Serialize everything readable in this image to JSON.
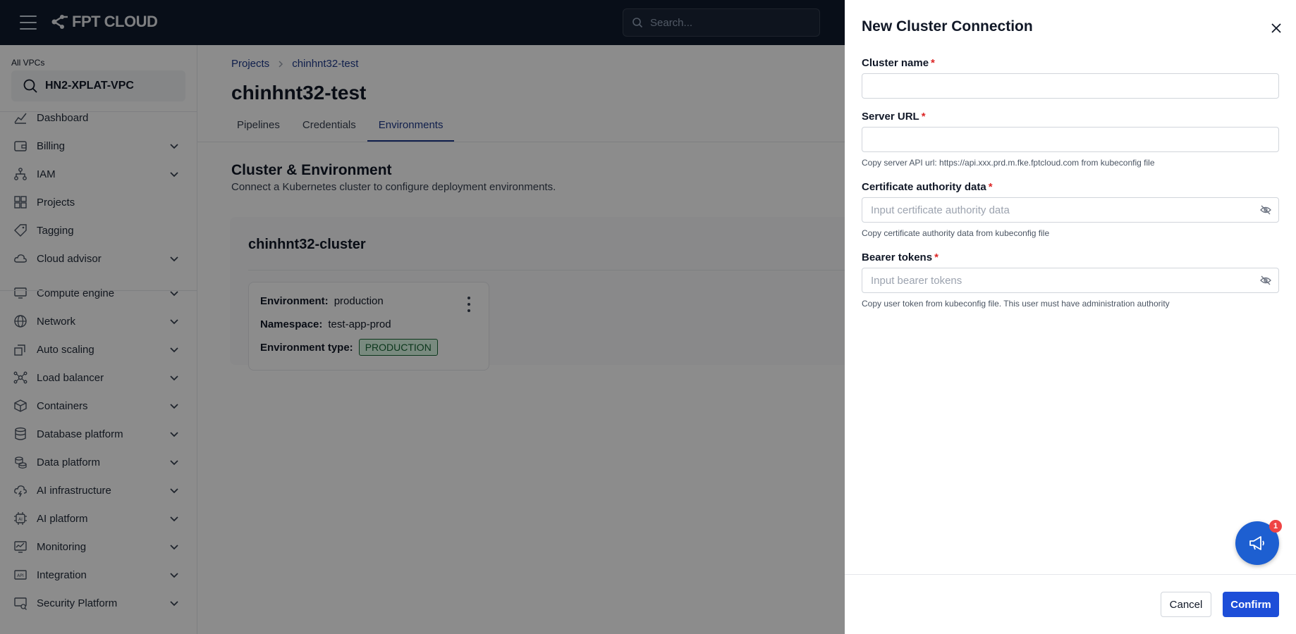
{
  "topbar": {
    "logo_text": "FPT CLOUD",
    "search_placeholder": "Search..."
  },
  "sidebar": {
    "vpc_label": "All VPCs",
    "vpc_name": "HN2-XPLAT-VPC",
    "items": [
      {
        "label": "Dashboard",
        "icon": "chart-line-icon",
        "expandable": false
      },
      {
        "label": "Billing",
        "icon": "wallet-icon",
        "expandable": true
      },
      {
        "label": "IAM",
        "icon": "hierarchy-icon",
        "expandable": true
      },
      {
        "label": "Projects",
        "icon": "grid-icon",
        "expandable": false
      },
      {
        "label": "Tagging",
        "icon": "tag-icon",
        "expandable": false
      },
      {
        "label": "Cloud advisor",
        "icon": "cloud-icon",
        "expandable": true
      },
      {
        "label": "Compute engine",
        "icon": "monitor-icon",
        "expandable": true
      },
      {
        "label": "Network",
        "icon": "globe-icon",
        "expandable": true
      },
      {
        "label": "Auto scaling",
        "icon": "scaling-icon",
        "expandable": true
      },
      {
        "label": "Load balancer",
        "icon": "network-nodes-icon",
        "expandable": true
      },
      {
        "label": "Containers",
        "icon": "box-icon",
        "expandable": true
      },
      {
        "label": "Database platform",
        "icon": "database-icon",
        "expandable": true
      },
      {
        "label": "Data platform",
        "icon": "coins-icon",
        "expandable": true
      },
      {
        "label": "AI infrastructure",
        "icon": "cloud-bolt-icon",
        "expandable": true
      },
      {
        "label": "AI platform",
        "icon": "ai-chip-icon",
        "expandable": true
      },
      {
        "label": "Monitoring",
        "icon": "monitoring-icon",
        "expandable": true
      },
      {
        "label": "Integration",
        "icon": "api-icon",
        "expandable": true
      },
      {
        "label": "Security Platform",
        "icon": "security-icon",
        "expandable": true
      }
    ]
  },
  "main": {
    "breadcrumb": [
      "Projects",
      "chinhnt32-test"
    ],
    "title": "chinhnt32-test",
    "tabs": [
      {
        "label": "Pipelines",
        "active": false
      },
      {
        "label": "Credentials",
        "active": false
      },
      {
        "label": "Environments",
        "active": true
      }
    ],
    "section_title": "Cluster & Environment",
    "section_subtitle": "Connect a Kubernetes cluster to configure deployment environments.",
    "cluster": {
      "name": "chinhnt32-cluster",
      "environment_label": "Environment:",
      "environment_value": "production",
      "namespace_label": "Namespace:",
      "namespace_value": "test-app-prod",
      "type_label": "Environment type:",
      "type_value": "PRODUCTION"
    }
  },
  "drawer": {
    "title": "New Cluster Connection",
    "fields": {
      "cluster_name": {
        "label": "Cluster name",
        "value": "",
        "placeholder": ""
      },
      "server_url": {
        "label": "Server URL",
        "value": "",
        "placeholder": "",
        "helper": "Copy server API url: https://api.xxx.prd.m.fke.fptcloud.com from kubeconfig file"
      },
      "ca_data": {
        "label": "Certificate authority data",
        "value": "",
        "placeholder": "Input certificate authority data",
        "helper": "Copy certificate authority data from kubeconfig file"
      },
      "bearer": {
        "label": "Bearer tokens",
        "value": "",
        "placeholder": "Input bearer tokens",
        "helper": "Copy user token from kubeconfig file. This user must have administration authority"
      }
    },
    "required_mark": "*",
    "cancel_label": "Cancel",
    "confirm_label": "Confirm"
  },
  "fab": {
    "badge_count": "1",
    "icon": "megaphone-icon"
  },
  "colors": {
    "accent": "#1d4ed8",
    "topbar": "#0f1b2d",
    "required": "#dc2626",
    "badge_green": "#166534"
  }
}
